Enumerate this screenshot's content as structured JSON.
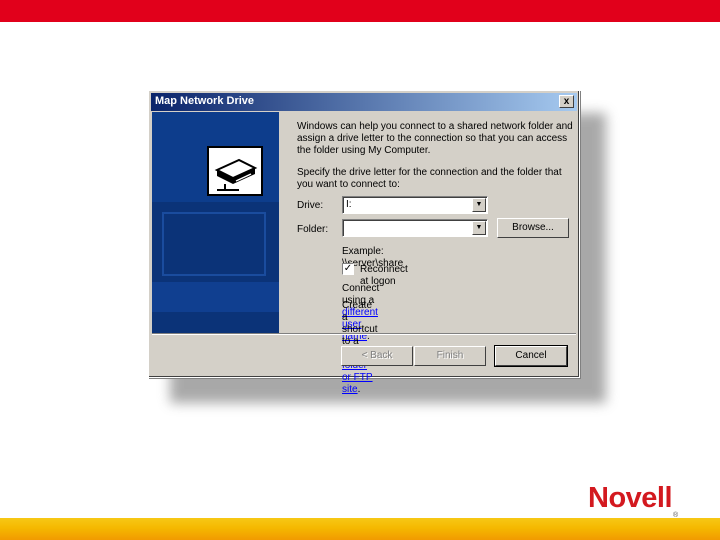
{
  "slide": {
    "logo_text": "Novell",
    "logo_mark": "®",
    "colors": {
      "top_bar": "#e1001b",
      "bottom_bar": "#f5b800",
      "logo": "#d3191f"
    }
  },
  "dialog": {
    "title": "Map Network Drive",
    "close_glyph": "x",
    "intro": "Windows can help you connect to a shared network folder and assign a drive letter to the connection so that you can access the folder using My Computer.",
    "instruction": "Specify the drive letter for the connection and the folder that you want to connect to:",
    "drive_label": "Drive:",
    "drive_value": "I:",
    "folder_label": "Folder:",
    "folder_value": "",
    "browse_label": "Browse...",
    "example": "Example: \\\\server\\share",
    "reconnect_label": "Reconnect at logon",
    "reconnect_checked": true,
    "connect_prefix": "Connect using a ",
    "connect_link": "different user name",
    "connect_suffix": ".",
    "shortcut_prefix": "Create a shortcut to a ",
    "shortcut_link": "Web folder or FTP site",
    "shortcut_suffix": ".",
    "back_label": "< Back",
    "finish_label": "Finish",
    "cancel_label": "Cancel",
    "icon": "network-drive-icon"
  }
}
